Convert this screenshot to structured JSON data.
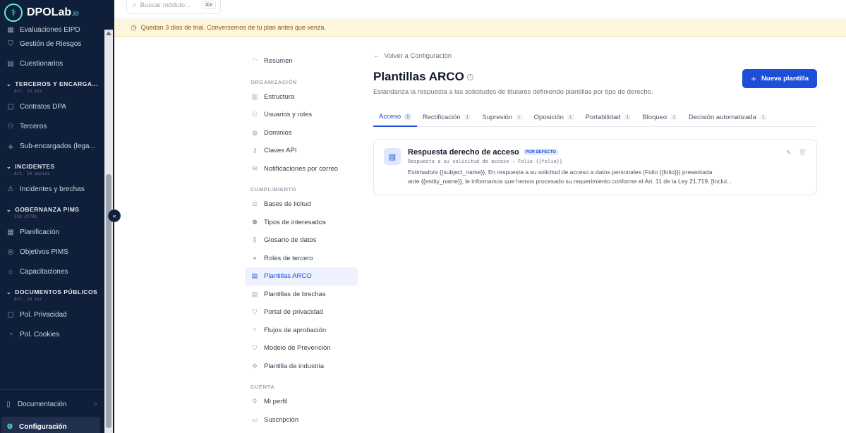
{
  "app": {
    "brand": "DPOLab",
    "brand_suffix": ".io"
  },
  "search": {
    "placeholder": "Buscar módulo...",
    "shortcut": "⌘K"
  },
  "trial_banner": "Quedan 3 días de trial. Conversemos de tu plan antes que venza.",
  "sidebar": {
    "cut_item": "Evaluaciones EIPD",
    "items_top": [
      {
        "label": "Gestión de Riesgos",
        "icon": "shield-icon"
      },
      {
        "label": "Cuestionarios",
        "icon": "clipboard-icon"
      }
    ],
    "sections": [
      {
        "title": "TERCEROS Y ENCARGA...",
        "sub": "Art. 15 bis",
        "items": [
          {
            "label": "Contratos DPA"
          },
          {
            "label": "Terceros"
          },
          {
            "label": "Sub-encargados (lega..."
          }
        ]
      },
      {
        "title": "INCIDENTES",
        "sub": "Art. 14 sexies",
        "items": [
          {
            "label": "Incidentes y brechas"
          }
        ]
      },
      {
        "title": "GOBERNANZA PIMS",
        "sub": "ISO 27701",
        "items": [
          {
            "label": "Planificación"
          },
          {
            "label": "Objetivos PIMS"
          },
          {
            "label": "Capacitaciones"
          }
        ]
      },
      {
        "title": "DOCUMENTOS PÚBLICOS",
        "sub": "Art. 14 ter",
        "items": [
          {
            "label": "Pol. Privacidad"
          },
          {
            "label": "Pol. Cookies"
          }
        ]
      }
    ],
    "footer": {
      "docs": "Documentación",
      "config": "Configuración"
    }
  },
  "settings_nav": {
    "summary": "Resumen",
    "org_title": "ORGANIZACIÓN",
    "org": [
      "Estructura",
      "Usuarios y roles",
      "Dominios",
      "Claves API",
      "Notificaciones por correo"
    ],
    "comp_title": "CUMPLIMIENTO",
    "comp": [
      "Bases de licitud",
      "Tipos de interesados",
      "Glosario de datos",
      "Roles de tercero",
      "Plantillas ARCO",
      "Plantillas de brechas",
      "Portal de privacidad",
      "Flujos de aprobación",
      "Modelo de Prevención",
      "Plantilla de industria"
    ],
    "account_title": "CUENTA",
    "account": [
      "Mi perfil",
      "Suscripción"
    ]
  },
  "main": {
    "back": "Volver a Configuración",
    "title": "Plantillas ARCO",
    "subtitle": "Estandariza la respuesta a las solicitudes de titulares definiendo plantillas por tipo de derecho.",
    "new_button": "Nueva plantilla",
    "tabs": [
      {
        "label": "Acceso",
        "count": "1"
      },
      {
        "label": "Rectificación",
        "count": "1"
      },
      {
        "label": "Supresión",
        "count": "1"
      },
      {
        "label": "Oposición",
        "count": "1"
      },
      {
        "label": "Portabilidad",
        "count": "1"
      },
      {
        "label": "Bloqueo",
        "count": "1"
      },
      {
        "label": "Decisión automatizada",
        "count": "1"
      }
    ],
    "card": {
      "name": "Respuesta derecho de acceso",
      "badge": "POR DEFECTO",
      "subject": "Respuesta a su solicitud de acceso — Folio {{folio}}",
      "body_line1": "Estimado/a {{subject_name}}, En respuesta a su solicitud de acceso a datos personales (Folio {{folio}}) presentada",
      "body_line2": "ante {{entity_name}}, le informamos que hemos procesado su requerimiento conforme el Art. 11 de la Ley 21.719. [Inclui..."
    }
  },
  "colors": {
    "sidebar_bg": "#0f1f3a",
    "primary": "#1d4ed8",
    "trial_bg": "#fef6dc",
    "accent": "#5eead4"
  }
}
